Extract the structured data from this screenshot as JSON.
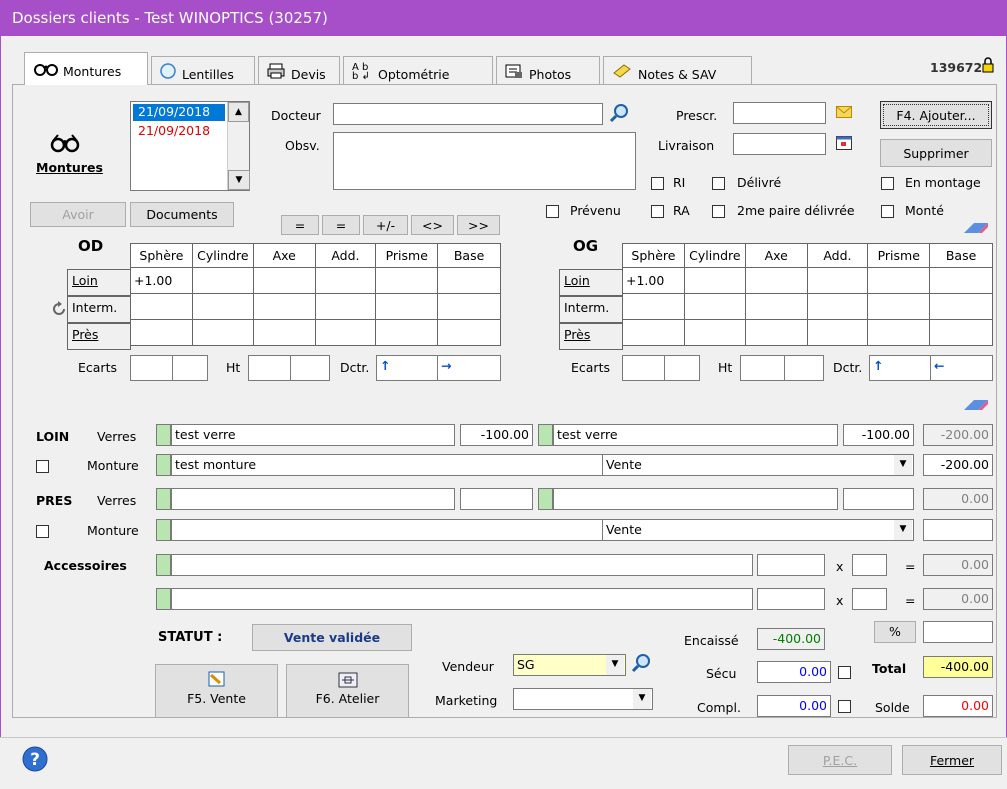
{
  "window": {
    "title": "Dossiers clients - Test WINOPTICS (30257)"
  },
  "tabs": [
    {
      "label": "Montures",
      "icon": "glasses-icon"
    },
    {
      "label": "Lentilles",
      "icon": "lens-icon"
    },
    {
      "label": "Devis",
      "icon": "printer-icon"
    },
    {
      "label": "Optométrie",
      "icon": "letters-icon"
    },
    {
      "label": "Photos",
      "icon": "photo-icon"
    },
    {
      "label": "Notes & SAV",
      "icon": "notes-icon"
    }
  ],
  "header": {
    "code": "139672"
  },
  "side": {
    "title": "Montures",
    "avoir": "Avoir",
    "documents": "Documents"
  },
  "dates": {
    "items": [
      "21/09/2018",
      "21/09/2018"
    ]
  },
  "form": {
    "docteur_label": "Docteur",
    "docteur_value": "",
    "obsv_label": "Obsv.",
    "obsv_value": "",
    "prescr_label": "Prescr.",
    "prescr_value": "",
    "livraison_label": "Livraison",
    "livraison_value": "",
    "ajouter": "F4. Ajouter...",
    "supprimer": "Supprimer",
    "ri": "RI",
    "delivre": "Délivré",
    "en_montage": "En montage",
    "prevenu": "Prévenu",
    "ra": "RA",
    "paire2": "2me paire délivrée",
    "monte": "Monté"
  },
  "rx_tools": [
    "=",
    "=",
    "+/-",
    "<>",
    ">>"
  ],
  "rx": {
    "od": "OD",
    "og": "OG",
    "columns": [
      "Sphère",
      "Cylindre",
      "Axe",
      "Add.",
      "Prisme",
      "Base"
    ],
    "rows": [
      "Loin",
      "Interm.",
      "Près"
    ],
    "od_values": [
      [
        "+1.00",
        "",
        "",
        "",
        "",
        ""
      ],
      [
        "",
        "",
        "",
        "",
        "",
        ""
      ],
      [
        "",
        "",
        "",
        "",
        "",
        ""
      ]
    ],
    "og_values": [
      [
        "+1.00",
        "",
        "",
        "",
        "",
        ""
      ],
      [
        "",
        "",
        "",
        "",
        "",
        ""
      ],
      [
        "",
        "",
        "",
        "",
        "",
        ""
      ]
    ],
    "ecarts": "Ecarts",
    "ht": "Ht",
    "dctr": "Dctr.",
    "od_arrows": [
      "↑",
      "→"
    ],
    "og_arrows": [
      "↑",
      "←"
    ]
  },
  "loin": {
    "title": "LOIN",
    "verres": "Verres",
    "verre_od": "test verre",
    "price_od": "-100.00",
    "verre_og": "test verre",
    "price_og": "-100.00",
    "total_verres": "-200.00",
    "monture_label": "Monture",
    "monture": "test monture",
    "type": "Vente",
    "total_monture": "-200.00"
  },
  "pres": {
    "title": "PRES",
    "verres": "Verres",
    "verre_od": "",
    "price_od": "",
    "verre_og": "",
    "price_og": "",
    "total_verres": "0.00",
    "monture_label": "Monture",
    "monture": "",
    "type": "Vente",
    "total_monture": ""
  },
  "accessoires": {
    "label": "Accessoires",
    "rows": [
      {
        "name": "",
        "price": "",
        "x": "x",
        "qty": "",
        "eq": "=",
        "total": "0.00"
      },
      {
        "name": "",
        "price": "",
        "x": "x",
        "qty": "",
        "eq": "=",
        "total": "0.00"
      }
    ]
  },
  "statut": {
    "label": "STATUT :",
    "value": "Vente validée"
  },
  "actions": {
    "vente": "F5. Vente",
    "atelier": "F6. Atelier"
  },
  "vendeur": {
    "label": "Vendeur",
    "value": "SG",
    "marketing_label": "Marketing",
    "marketing_value": ""
  },
  "totals": {
    "encaisse_label": "Encaissé",
    "encaisse": "-400.00",
    "secu_label": "Sécu",
    "secu": "0.00",
    "compl_label": "Compl.",
    "compl": "0.00",
    "pct": "%",
    "pct_value": "",
    "total_label": "Total",
    "total": "-400.00",
    "solde_label": "Solde",
    "solde": "0.00"
  },
  "footer": {
    "pec": "P.E.C.",
    "fermer": "Fermer"
  },
  "colors": {
    "title": "#a64fc9",
    "green": "#b9e5b0",
    "total": "#ffff99",
    "solde": "#ff0000",
    "encaisse": "#008000",
    "secu": "#0000ff"
  }
}
